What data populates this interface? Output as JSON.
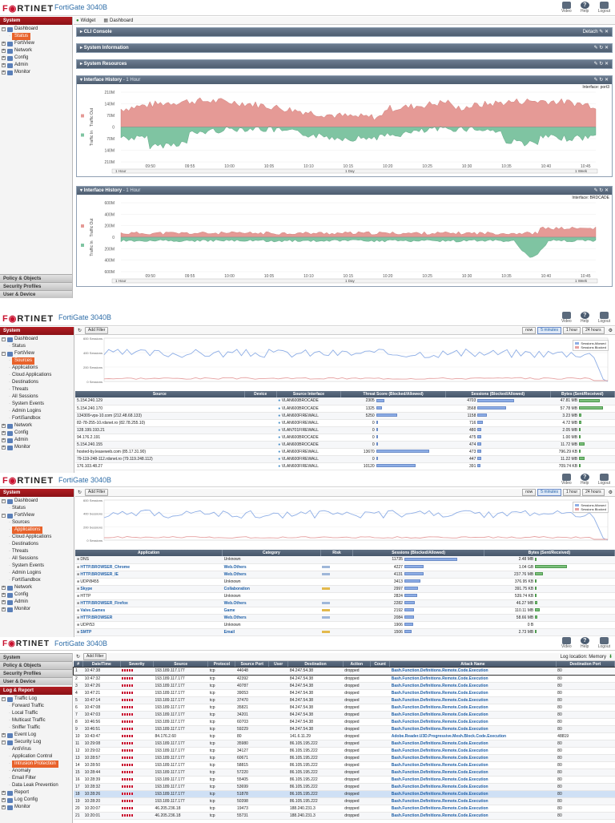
{
  "brand": {
    "logo_left": "F",
    "logo_right": "RTINET",
    "model": "FortiGate 3040B"
  },
  "topbar": {
    "video": "Video",
    "help": "Help",
    "logout": "Logout"
  },
  "shot1": {
    "sidebar": {
      "header": "System",
      "items": [
        {
          "label": "Dashboard",
          "level": 0,
          "box": "−"
        },
        {
          "label": "Status",
          "level": 1,
          "selected": true
        },
        {
          "label": "FortiView",
          "level": 0,
          "box": "+"
        },
        {
          "label": "Network",
          "level": 0,
          "box": "+"
        },
        {
          "label": "Config",
          "level": 0,
          "box": "+"
        },
        {
          "label": "Admin",
          "level": 0,
          "box": "+"
        },
        {
          "label": "Monitor",
          "level": 0,
          "box": "+"
        }
      ],
      "bottom": [
        "Policy & Objects",
        "Security Profiles",
        "User & Device"
      ]
    },
    "toolbar": {
      "widget": "Widget",
      "dashboard": "Dashboard"
    },
    "widgets": {
      "cli": {
        "title": "CLI Console",
        "detach": "Detach"
      },
      "sysinfo": {
        "title": "System Information"
      },
      "sysres": {
        "title": "System Resources"
      }
    },
    "ih1": {
      "title": "Interface History",
      "sub": "- 1 Hour",
      "iface": "Interface: port3",
      "yticks": [
        "210M",
        "140M",
        "70M",
        "0",
        "70M",
        "140M",
        "210M"
      ],
      "xticks": [
        "09:50",
        "09:55",
        "10:00",
        "10:05",
        "10:10",
        "10:15",
        "10:20",
        "10:25",
        "10:30",
        "10:35",
        "10:40",
        "10:45"
      ],
      "out_label": "Traffic Out",
      "in_label": "Traffic In",
      "range": [
        "1 Hour",
        "1 Day",
        "1 Week"
      ]
    },
    "ih2": {
      "title": "Interface History",
      "sub": "- 1 Hour",
      "iface": "Interface: BRDCADE",
      "yticks": [
        "600M",
        "400M",
        "200M",
        "0",
        "200M",
        "400M",
        "600M"
      ],
      "xticks": [
        "09:50",
        "09:55",
        "10:00",
        "10:05",
        "10:10",
        "10:15",
        "10:20",
        "10:25",
        "10:30",
        "10:35",
        "10:40",
        "10:45"
      ],
      "out_label": "Traffic Out",
      "in_label": "Traffic In",
      "range": [
        "1 Hour",
        "1 Day",
        "1 Week"
      ]
    }
  },
  "shot2": {
    "sidebar": {
      "header": "System",
      "items": [
        {
          "label": "Dashboard",
          "level": 0,
          "box": "−"
        },
        {
          "label": "Status",
          "level": 1
        },
        {
          "label": "FortiView",
          "level": 0,
          "box": "−"
        },
        {
          "label": "Sources",
          "level": 1,
          "selected": true
        },
        {
          "label": "Applications",
          "level": 1
        },
        {
          "label": "Cloud Applications",
          "level": 1
        },
        {
          "label": "Destinations",
          "level": 1
        },
        {
          "label": "Threats",
          "level": 1
        },
        {
          "label": "All Sessions",
          "level": 1
        },
        {
          "label": "System Events",
          "level": 1
        },
        {
          "label": "Admin Logins",
          "level": 1
        },
        {
          "label": "FortiSandbox",
          "level": 1
        },
        {
          "label": "Network",
          "level": 0,
          "box": "+"
        },
        {
          "label": "Config",
          "level": 0,
          "box": "+"
        },
        {
          "label": "Admin",
          "level": 0,
          "box": "+"
        },
        {
          "label": "Monitor",
          "level": 0,
          "box": "+"
        }
      ]
    },
    "add_filter": "Add Filter",
    "timeframes": [
      "now",
      "5 minutes",
      "1 hour",
      "24 hours"
    ],
    "legend": [
      "Sessions Allowed",
      "Sessions Blocked"
    ],
    "yticks": [
      "600 Sessions",
      "400 Sessions",
      "200 Sessions",
      "0 Sessions"
    ],
    "columns": [
      "Source",
      "Device",
      "Source Interface",
      "Threat Score (Blocked/Allowed)",
      "Sessions (Blocked/Allowed)",
      "Bytes (Sent/Received)"
    ],
    "rows": [
      {
        "src": "5.154.240.129",
        "iface": "VLAN600BROCADE",
        "threat": "2305",
        "tbar": 10,
        "sess": "4703",
        "sbar": 46,
        "bytes": "47.81 MB",
        "bbar": 26
      },
      {
        "src": "5.154.240.170",
        "iface": "VLAN600BROCADE",
        "threat": "1325",
        "tbar": 7,
        "sess": "3568",
        "sbar": 36,
        "bytes": "57.78 MB",
        "bbar": 30
      },
      {
        "src": "134309-vps-10.com (212.48.68.133)",
        "iface": "VLAN600FIREWALL",
        "threat": "5250",
        "tbar": 26,
        "sess": "1158",
        "sbar": 12,
        "bytes": "3.23 MB",
        "bbar": 3
      },
      {
        "src": "82-78-255-10.rdsnet.ro (82.78.255.10)",
        "iface": "VLAN600FIREWALL",
        "threat": "0",
        "tbar": 0,
        "sess": "716",
        "sbar": 7,
        "bytes": "4.72 MB",
        "bbar": 3
      },
      {
        "src": "128.199.193.21",
        "iface": "VLAN701FIREWALL",
        "threat": "0",
        "tbar": 0,
        "sess": "480",
        "sbar": 5,
        "bytes": "2.05 MB",
        "bbar": 2
      },
      {
        "src": "94.176.2.191",
        "iface": "VLAN600BROCADE",
        "threat": "0",
        "tbar": 0,
        "sess": "475",
        "sbar": 5,
        "bytes": "1.00 MB",
        "bbar": 1
      },
      {
        "src": "5.154.240.155",
        "iface": "VLAN600BROCADE",
        "threat": "0",
        "tbar": 0,
        "sess": "474",
        "sbar": 5,
        "bytes": "11.72 MB",
        "bbar": 7
      },
      {
        "src": "hosted-by.leaseweb.com (85.17.31.90)",
        "iface": "VLAN600FIREWALL",
        "threat": "13670",
        "tbar": 66,
        "sess": "473",
        "sbar": 5,
        "bytes": "796.29 KB",
        "bbar": 1
      },
      {
        "src": "79-119-248-112.rdsnet.ro (79.119.248.112)",
        "iface": "VLAN600FIREWALL",
        "threat": "0",
        "tbar": 0,
        "sess": "447",
        "sbar": 5,
        "bytes": "11.22 MB",
        "bbar": 7
      },
      {
        "src": "176.103.48.27",
        "iface": "VLAN600FIREWALL",
        "threat": "10120",
        "tbar": 49,
        "sess": "391",
        "sbar": 4,
        "bytes": "709.74 KB",
        "bbar": 1
      }
    ]
  },
  "shot3": {
    "sidebar": {
      "header": "System",
      "items": [
        {
          "label": "Dashboard",
          "level": 0,
          "box": "−"
        },
        {
          "label": "Status",
          "level": 1
        },
        {
          "label": "FortiView",
          "level": 0,
          "box": "−"
        },
        {
          "label": "Sources",
          "level": 1
        },
        {
          "label": "Applications",
          "level": 1,
          "selected": true
        },
        {
          "label": "Cloud Applications",
          "level": 1
        },
        {
          "label": "Destinations",
          "level": 1
        },
        {
          "label": "Threats",
          "level": 1
        },
        {
          "label": "All Sessions",
          "level": 1
        },
        {
          "label": "System Events",
          "level": 1
        },
        {
          "label": "Admin Logins",
          "level": 1
        },
        {
          "label": "FortiSandbox",
          "level": 1
        },
        {
          "label": "Network",
          "level": 0,
          "box": "+"
        },
        {
          "label": "Config",
          "level": 0,
          "box": "+"
        },
        {
          "label": "Admin",
          "level": 0,
          "box": "+"
        },
        {
          "label": "Monitor",
          "level": 0,
          "box": "+"
        }
      ]
    },
    "add_filter": "Add Filter",
    "timeframes": [
      "now",
      "5 minutes",
      "1 hour",
      "24 hours"
    ],
    "legend": [
      "Sessions Allowed",
      "Sessions Blocked"
    ],
    "yticks": [
      "600 Sessions",
      "400 Sessions",
      "200 Sessions",
      "0 Sessions"
    ],
    "columns": [
      "Application",
      "Category",
      "Risk",
      "Sessions (Blocked/Allowed)",
      "Bytes (Sent/Received)"
    ],
    "rows": [
      {
        "app": "DNS",
        "cat": "Unknown",
        "risk": "",
        "sess": "11735",
        "sbar": 66,
        "bytes": "2.48 MB",
        "bbar": 1,
        "link": false
      },
      {
        "app": "HTTP.BROWSER_Chrome",
        "cat": "Web.Others",
        "risk": "b",
        "sess": "4227",
        "sbar": 24,
        "bytes": "1.04 GB",
        "bbar": 40,
        "link": true
      },
      {
        "app": "HTTP.BROWSER_IE",
        "cat": "Web.Others",
        "risk": "b",
        "sess": "4131",
        "sbar": 24,
        "bytes": "237.76 MB",
        "bbar": 10,
        "link": true
      },
      {
        "app": "UDP/8455",
        "cat": "Unknown",
        "risk": "",
        "sess": "3413",
        "sbar": 20,
        "bytes": "376.95 KB",
        "bbar": 1,
        "link": false
      },
      {
        "app": "Skype",
        "cat": "Collaboration",
        "risk": "y",
        "sess": "2997",
        "sbar": 17,
        "bytes": "391.75 KB",
        "bbar": 1,
        "link": true
      },
      {
        "app": "HTTP",
        "cat": "Unknown",
        "risk": "",
        "sess": "2824",
        "sbar": 16,
        "bytes": "539.74 KB",
        "bbar": 1,
        "link": false
      },
      {
        "app": "HTTP.BROWSER_Firefox",
        "cat": "Web.Others",
        "risk": "b",
        "sess": "2282",
        "sbar": 13,
        "bytes": "46.27 MB",
        "bbar": 3,
        "link": true
      },
      {
        "app": "Valve.Games",
        "cat": "Game",
        "risk": "y",
        "sess": "2192",
        "sbar": 12,
        "bytes": "110.11 MB",
        "bbar": 6,
        "link": true
      },
      {
        "app": "HTTP.BROWSER",
        "cat": "Web.Others",
        "risk": "b",
        "sess": "2084",
        "sbar": 12,
        "bytes": "58.66 MB",
        "bbar": 3,
        "link": true
      },
      {
        "app": "UDP/53",
        "cat": "Unknown",
        "risk": "",
        "sess": "1906",
        "sbar": 11,
        "bytes": "0 B",
        "bbar": 0,
        "link": false
      },
      {
        "app": "SMTP",
        "cat": "Email",
        "risk": "y",
        "sess": "1506",
        "sbar": 9,
        "bytes": "2.73 MB",
        "bbar": 1,
        "link": true
      }
    ]
  },
  "shot4": {
    "sidebar": {
      "top": [
        "System",
        "Policy & Objects",
        "Security Profiles",
        "User & Device"
      ],
      "header": "Log & Report",
      "items": [
        {
          "label": "Traffic Log",
          "level": 0,
          "box": "−"
        },
        {
          "label": "Forward Traffic",
          "level": 1
        },
        {
          "label": "Local Traffic",
          "level": 1
        },
        {
          "label": "Multicast Traffic",
          "level": 1
        },
        {
          "label": "Sniffer Traffic",
          "level": 1
        },
        {
          "label": "Event Log",
          "level": 0,
          "box": "+"
        },
        {
          "label": "Security Log",
          "level": 0,
          "box": "−"
        },
        {
          "label": "AntiVirus",
          "level": 1
        },
        {
          "label": "Application Control",
          "level": 1
        },
        {
          "label": "Intrusion Protection",
          "level": 1,
          "selected": true
        },
        {
          "label": "Anomaly",
          "level": 1
        },
        {
          "label": "Email Filter",
          "level": 1
        },
        {
          "label": "Data Leak Prevention",
          "level": 1
        },
        {
          "label": "Report",
          "level": 0,
          "box": "+"
        },
        {
          "label": "Log Config",
          "level": 0,
          "box": "+"
        },
        {
          "label": "Monitor",
          "level": 0,
          "box": "+"
        }
      ]
    },
    "add_filter": "Add Filter",
    "log_location": "Log location: Memory",
    "columns": [
      "#",
      "Date/Time",
      "Severity",
      "Source",
      "Protocol",
      "Source Port",
      "User",
      "Destination",
      "Action",
      "Count",
      "Attack Name",
      "Destination Port"
    ],
    "rows": [
      [
        "1",
        "10:47:38",
        "193.189.117.177",
        "tcp",
        "44048",
        "84.247.54.38",
        "dropped",
        "Bash.Function.Definitions.Remote.Code.Execution",
        "80"
      ],
      [
        "2",
        "10:47:32",
        "193.189.117.177",
        "tcp",
        "42392",
        "84.247.54.38",
        "dropped",
        "Bash.Function.Definitions.Remote.Code.Execution",
        "80"
      ],
      [
        "3",
        "10:47:26",
        "193.189.117.177",
        "tcp",
        "40787",
        "84.247.54.38",
        "dropped",
        "Bash.Function.Definitions.Remote.Code.Execution",
        "80"
      ],
      [
        "4",
        "10:47:21",
        "193.189.117.177",
        "tcp",
        "39053",
        "84.247.54.38",
        "dropped",
        "Bash.Function.Definitions.Remote.Code.Execution",
        "80"
      ],
      [
        "5",
        "10:47:14",
        "193.189.117.177",
        "tcp",
        "37470",
        "84.247.54.38",
        "dropped",
        "Bash.Function.Definitions.Remote.Code.Execution",
        "80"
      ],
      [
        "6",
        "10:47:08",
        "193.189.117.177",
        "tcp",
        "35821",
        "84.247.54.38",
        "dropped",
        "Bash.Function.Definitions.Remote.Code.Execution",
        "80"
      ],
      [
        "7",
        "10:47:03",
        "193.189.117.177",
        "tcp",
        "34201",
        "84.247.54.38",
        "dropped",
        "Bash.Function.Definitions.Remote.Code.Execution",
        "80"
      ],
      [
        "8",
        "10:46:56",
        "193.189.117.177",
        "tcp",
        "60703",
        "84.247.54.38",
        "dropped",
        "Bash.Function.Definitions.Remote.Code.Execution",
        "80"
      ],
      [
        "9",
        "10:46:51",
        "193.189.117.177",
        "tcp",
        "59229",
        "84.247.54.38",
        "dropped",
        "Bash.Function.Definitions.Remote.Code.Execution",
        "80"
      ],
      [
        "10",
        "10:43:47",
        "84.176.2.60",
        "tcp",
        "80",
        "141.6.11.29",
        "dropped",
        "Adobe.Reader.U3D.Progressive.Mesh.Block.Code.Execution",
        "48819"
      ],
      [
        "11",
        "10:29:08",
        "193.189.117.177",
        "tcp",
        "35980",
        "86.105.195.222",
        "dropped",
        "Bash.Function.Definitions.Remote.Code.Execution",
        "80"
      ],
      [
        "12",
        "10:29:02",
        "193.189.117.177",
        "tcp",
        "34127",
        "86.105.195.222",
        "dropped",
        "Bash.Function.Definitions.Remote.Code.Execution",
        "80"
      ],
      [
        "13",
        "10:28:57",
        "193.189.117.177",
        "tcp",
        "60671",
        "86.105.195.222",
        "dropped",
        "Bash.Function.Definitions.Remote.Code.Execution",
        "80"
      ],
      [
        "14",
        "10:28:50",
        "193.189.117.177",
        "tcp",
        "58815",
        "86.105.195.222",
        "dropped",
        "Bash.Function.Definitions.Remote.Code.Execution",
        "80"
      ],
      [
        "15",
        "10:28:44",
        "193.189.117.177",
        "tcp",
        "57220",
        "86.105.195.222",
        "dropped",
        "Bash.Function.Definitions.Remote.Code.Execution",
        "80"
      ],
      [
        "16",
        "10:28:39",
        "193.189.117.177",
        "tcp",
        "55405",
        "86.105.195.222",
        "dropped",
        "Bash.Function.Definitions.Remote.Code.Execution",
        "80"
      ],
      [
        "17",
        "10:28:32",
        "193.189.117.177",
        "tcp",
        "53699",
        "86.105.195.222",
        "dropped",
        "Bash.Function.Definitions.Remote.Code.Execution",
        "80"
      ],
      [
        "18",
        "10:28:26",
        "193.189.117.177",
        "tcp",
        "51878",
        "86.105.195.222",
        "dropped",
        "Bash.Function.Definitions.Remote.Code.Execution",
        "80"
      ],
      [
        "19",
        "10:28:20",
        "193.189.117.177",
        "tcp",
        "50398",
        "86.105.195.222",
        "dropped",
        "Bash.Function.Definitions.Remote.Code.Execution",
        "80"
      ],
      [
        "20",
        "10:20:07",
        "46.205.236.18",
        "tcp",
        "19473",
        "188.240.231.3",
        "dropped",
        "Bash.Function.Definitions.Remote.Code.Execution",
        "80"
      ],
      [
        "21",
        "10:20:01",
        "46.205.236.18",
        "tcp",
        "55731",
        "188.240.231.3",
        "dropped",
        "Bash.Function.Definitions.Remote.Code.Execution",
        "80"
      ]
    ]
  },
  "colors": {
    "brand_red": "#c8102e",
    "out_fill": "#e59a96",
    "in_fill": "#7fc4a2",
    "allowed_line": "#8eaee6",
    "blocked_line": "#e6a1a1",
    "selected_orange": "#e8622b"
  }
}
